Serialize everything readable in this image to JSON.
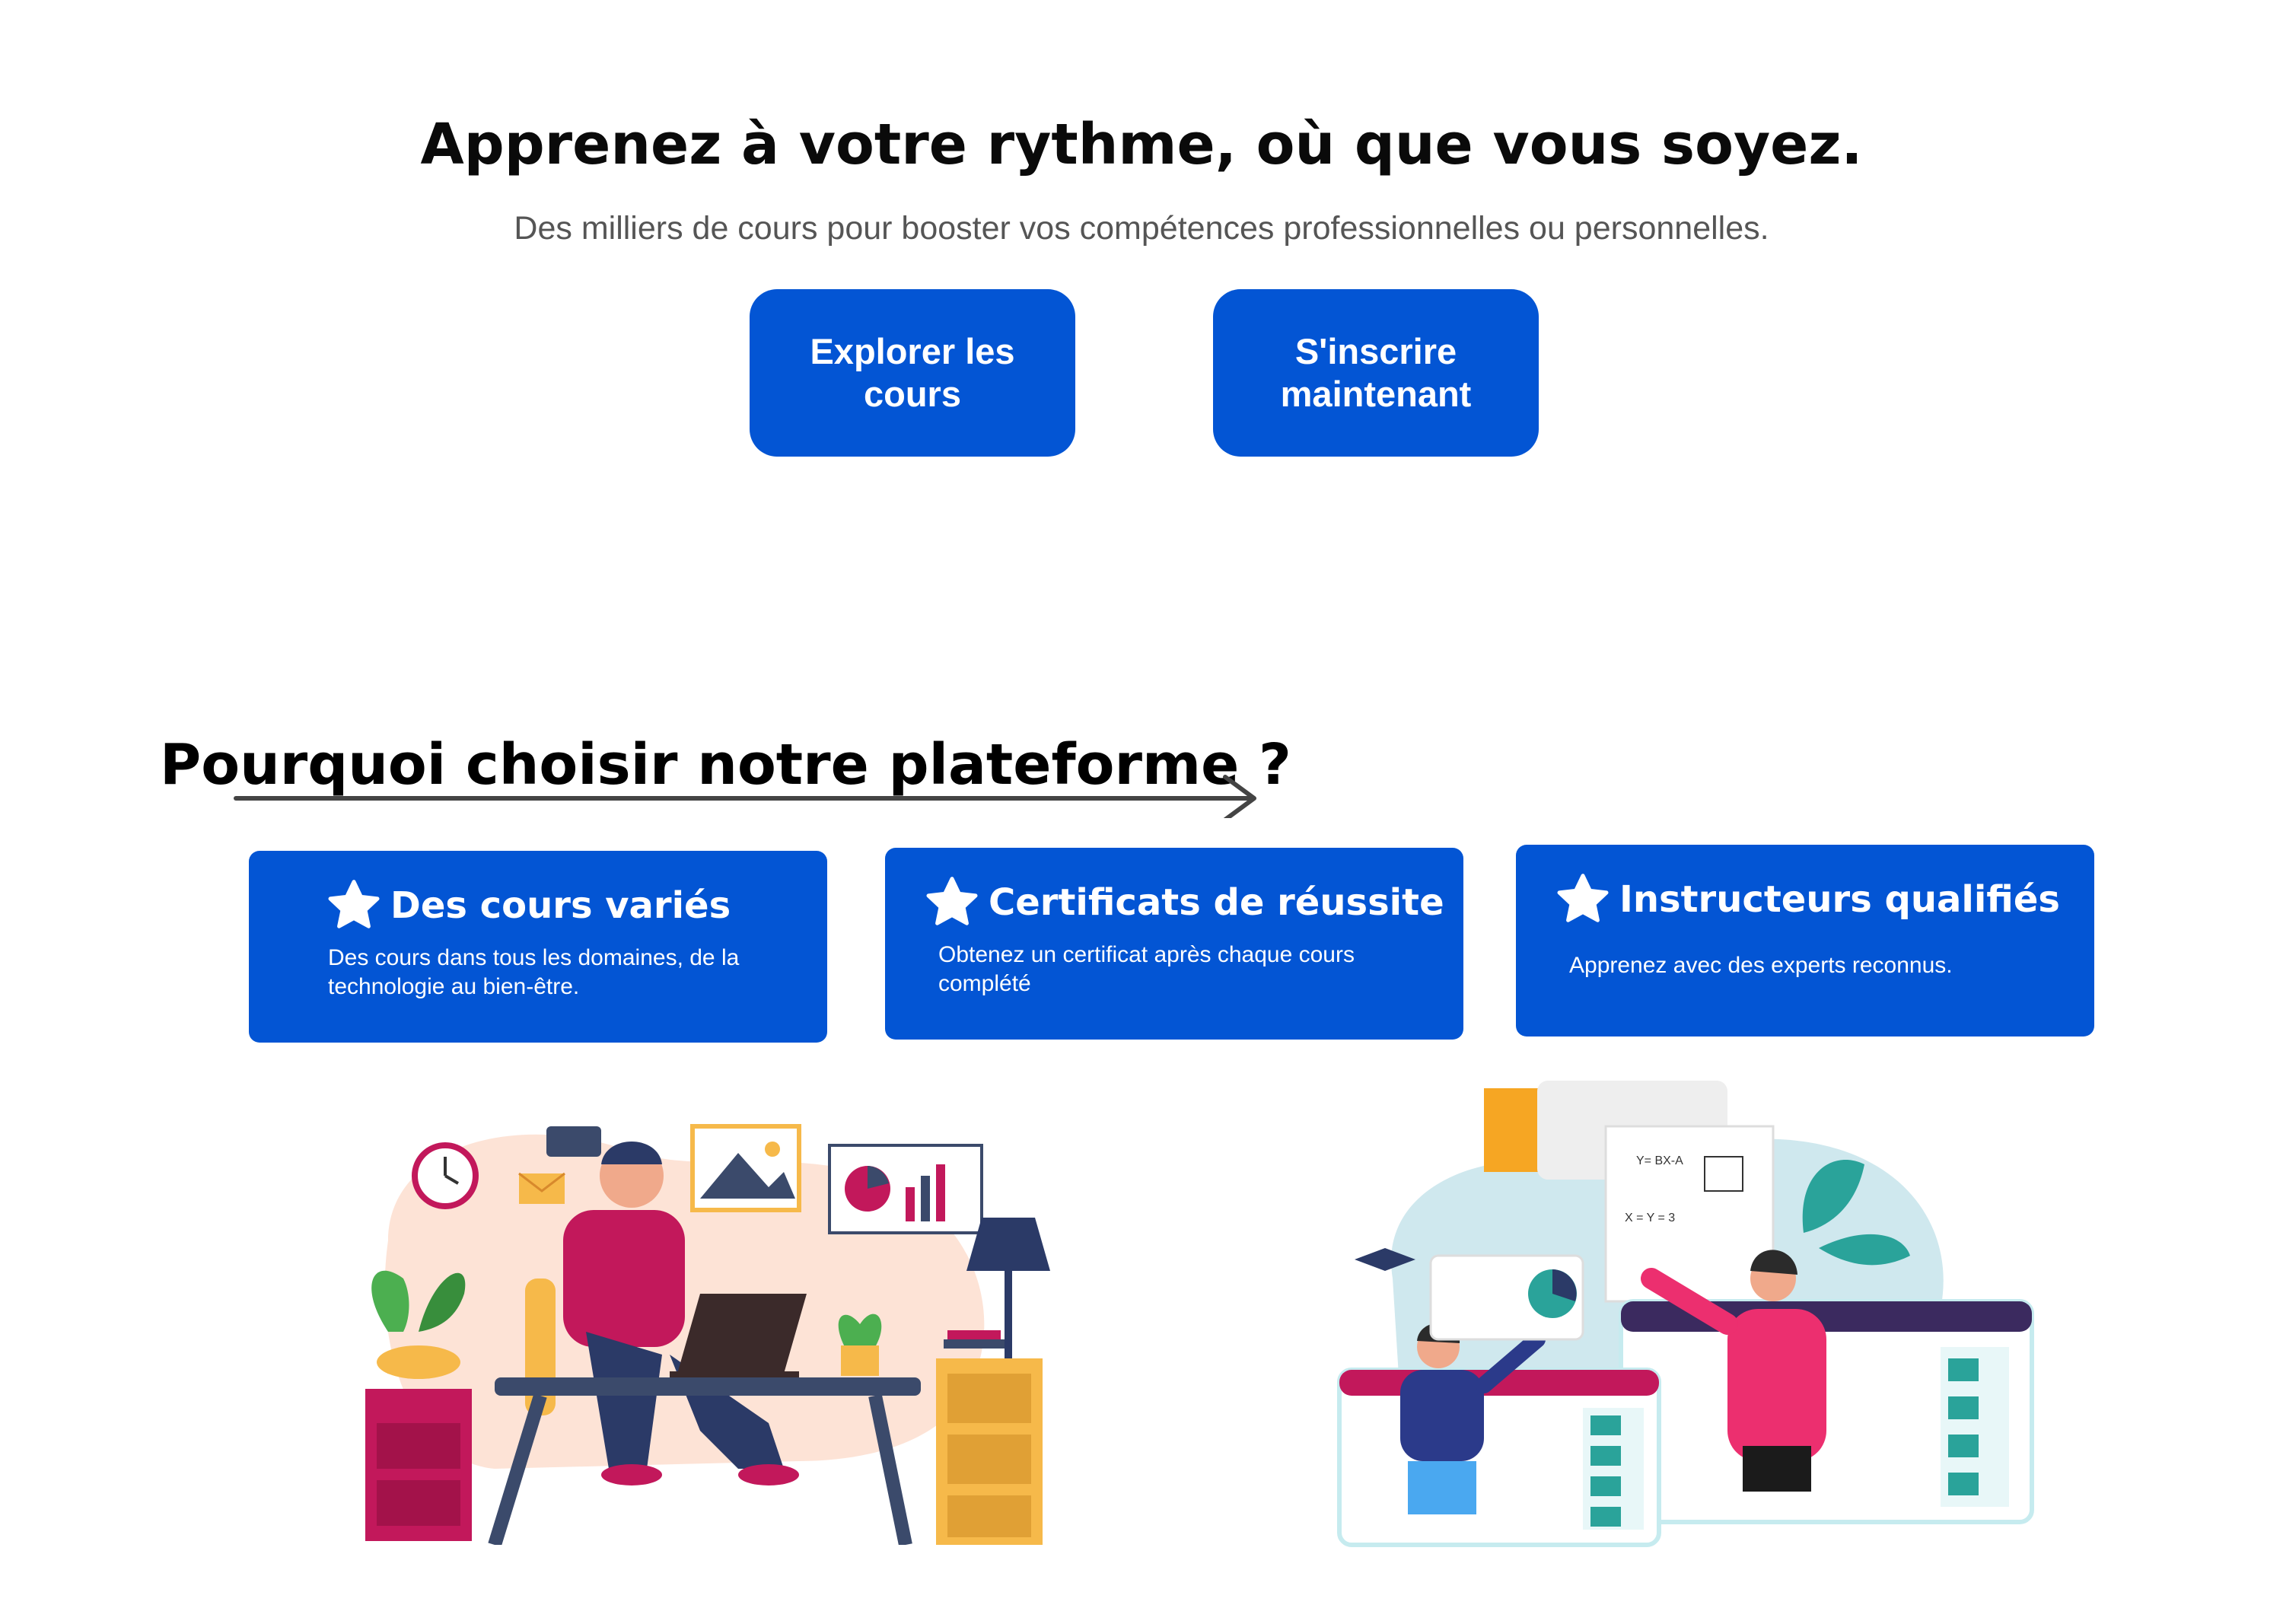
{
  "hero": {
    "title": "Apprenez à votre rythme, où que vous soyez.",
    "subtitle": "Des milliers de cours pour booster vos compétences professionnelles ou personnelles.",
    "buttons": [
      {
        "label": "Explorer les cours"
      },
      {
        "label": "S'inscrire maintenant"
      }
    ]
  },
  "features": {
    "title": "Pourquoi choisir notre plateforme ?",
    "cards": [
      {
        "icon": "star-icon",
        "title": "Des cours variés",
        "description": "Des cours dans tous les domaines, de la technologie au bien-être."
      },
      {
        "icon": "star-icon",
        "title": "Certificats de réussite",
        "description": "Obtenez un certificat après chaque cours complété"
      },
      {
        "icon": "star-icon",
        "title": "Instructeurs qualifiés",
        "description": "Apprenez avec des experts reconnus."
      }
    ]
  },
  "illustration": {
    "whiteboard_formula_1": "Y= BX-A",
    "whiteboard_formula_2": "X = Y = 3"
  },
  "colors": {
    "accent": "#0355d4",
    "text": "#0a0a0a",
    "muted": "#555555",
    "background": "#ffffff"
  }
}
